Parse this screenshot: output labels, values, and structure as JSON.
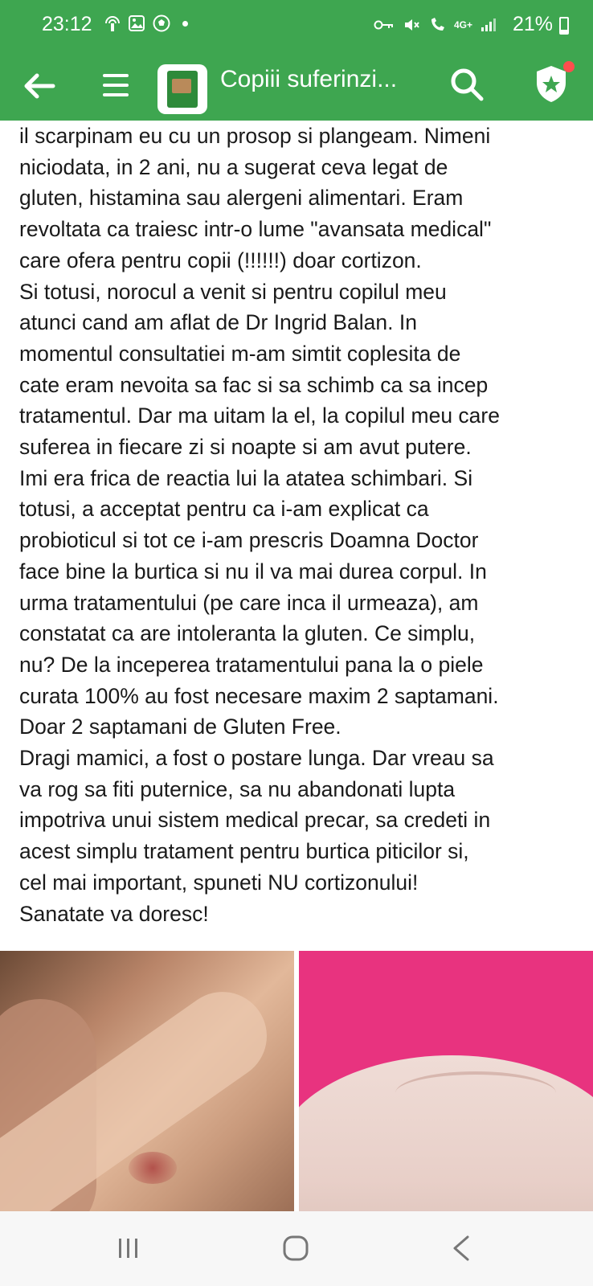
{
  "status_bar": {
    "time": "23:12",
    "network": "4G+",
    "battery": "21%"
  },
  "app_bar": {
    "title": "Copiii suferinzi..."
  },
  "post": {
    "lines": [
      "il scarpinam eu cu un prosop si plangeam. Nimeni",
      "niciodata, in 2 ani, nu a sugerat ceva legat de",
      "gluten, histamina sau alergeni alimentari. Eram",
      "revoltata ca traiesc intr-o lume \"avansata medical\"",
      "care ofera pentru copii (!!!!!!) doar cortizon.",
      "Si totusi, norocul a venit si pentru copilul meu",
      "atunci cand am aflat de Dr Ingrid Balan. In",
      "momentul consultatiei m-am simtit coplesita de",
      "cate eram nevoita sa fac si sa schimb ca sa incep",
      "tratamentul. Dar ma uitam la el, la copilul meu care",
      "suferea in fiecare zi si noapte si am avut putere.",
      "Imi era frica de reactia lui la atatea schimbari. Si",
      "totusi, a acceptat pentru ca i-am explicat ca",
      "probioticul si tot ce i-am prescris Doamna Doctor",
      "face bine la burtica si nu il va mai durea corpul. In",
      "urma tratamentului (pe care inca il urmeaza), am",
      "constatat ca are intoleranta la gluten. Ce simplu,",
      "nu? De la inceperea tratamentului pana la o piele",
      "curata 100% au fost necesare maxim 2 saptamani.",
      "Doar 2 saptamani de Gluten Free.",
      "Dragi mamici, a fost o postare lunga. Dar vreau sa",
      "va rog sa fiti puternice, sa nu abandonati lupta",
      "impotriva unui sistem medical precar, sa credeti in",
      "acest simplu tratament pentru burtica piticilor si,",
      "cel mai important, spuneti NU cortizonului!",
      "Sanatate va doresc!"
    ]
  },
  "colors": {
    "app_bar": "#3ea650",
    "notification_dot": "#ff4d4d",
    "photo_background_pink": "#e8337f"
  },
  "icons": {
    "back": "arrow-left-icon",
    "menu": "hamburger-menu-icon",
    "search": "search-icon",
    "shield": "shield-star-icon"
  }
}
